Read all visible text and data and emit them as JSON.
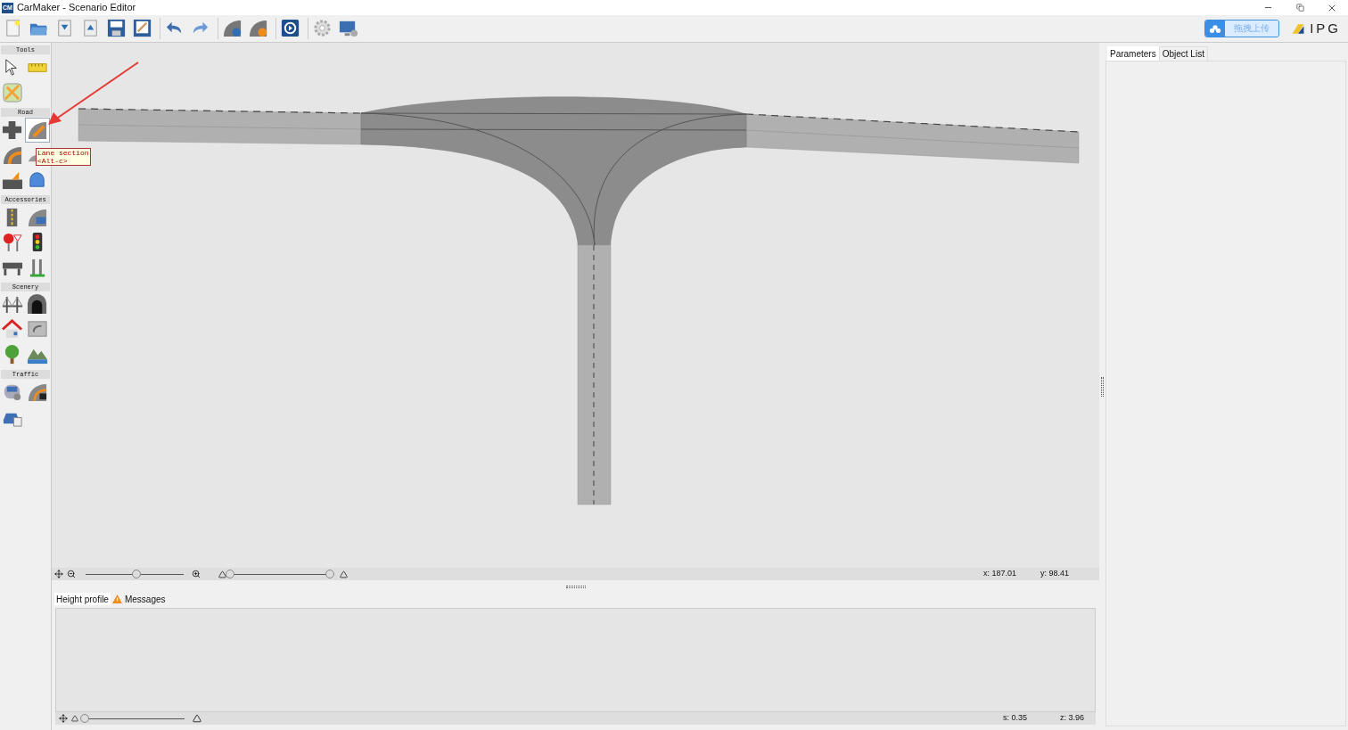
{
  "window": {
    "app_badge": "CM",
    "title": "CarMaker - Scenario Editor"
  },
  "toolbar": {
    "tools": [
      {
        "kind": "new"
      },
      {
        "kind": "open"
      },
      {
        "kind": "import"
      },
      {
        "kind": "export"
      },
      {
        "kind": "save"
      },
      {
        "kind": "saveas"
      },
      {
        "kind": "undo"
      },
      {
        "kind": "redo"
      },
      {
        "kind": "roadinfo"
      },
      {
        "kind": "roadhelp"
      },
      {
        "kind": "play"
      },
      {
        "kind": "settings"
      },
      {
        "kind": "display"
      }
    ],
    "upload_button": "拖拽上传",
    "logo": "IPG"
  },
  "sidebar": {
    "sections": [
      {
        "title": "Tools",
        "tools": [
          {
            "kind": "pointer",
            "selected": false
          },
          {
            "kind": "ruler",
            "selected": false
          },
          {
            "kind": "map",
            "selected": false
          }
        ]
      },
      {
        "title": "Road",
        "tools": [
          {
            "kind": "junction",
            "selected": false
          },
          {
            "kind": "lanesection",
            "selected": true
          },
          {
            "kind": "curve",
            "selected": false
          },
          {
            "kind": "bump",
            "selected": false
          },
          {
            "kind": "ramp",
            "selected": false
          },
          {
            "kind": "dome",
            "selected": false
          }
        ]
      },
      {
        "title": "Accessories",
        "tools": [
          {
            "kind": "marking",
            "selected": false
          },
          {
            "kind": "roadsign",
            "selected": false
          },
          {
            "kind": "stop",
            "selected": false
          },
          {
            "kind": "trafficlight",
            "selected": false
          },
          {
            "kind": "barrier",
            "selected": false
          },
          {
            "kind": "post",
            "selected": false
          }
        ]
      },
      {
        "title": "Scenery",
        "tools": [
          {
            "kind": "bridge",
            "selected": false
          },
          {
            "kind": "tunnel",
            "selected": false
          },
          {
            "kind": "house",
            "selected": false
          },
          {
            "kind": "billboard",
            "selected": false
          },
          {
            "kind": "tree",
            "selected": false
          },
          {
            "kind": "landscape",
            "selected": false
          }
        ]
      },
      {
        "title": "Traffic",
        "tools": [
          {
            "kind": "vehicle",
            "selected": false
          },
          {
            "kind": "route",
            "selected": false
          },
          {
            "kind": "car",
            "selected": false
          }
        ]
      }
    ]
  },
  "tooltip": {
    "lines": [
      "Lane section",
      "<Alt-c>"
    ]
  },
  "canvas": {
    "zoom_slider": {
      "level": 0.52
    },
    "height_range": {
      "low": {
        "level": 0
      },
      "high": {
        "level": 1
      }
    },
    "coords": [
      "x: 187.01",
      "y: 98.41"
    ]
  },
  "bottom_panel": {
    "tabs": [
      {
        "label": "Height profile",
        "selected": true,
        "kind": "plain"
      },
      {
        "label": "Messages",
        "selected": false,
        "kind": "warning"
      }
    ],
    "slider": {
      "level": 0
    },
    "readouts": [
      "s: 0.35",
      "z: 3.96"
    ]
  },
  "right_panel": {
    "tabs": [
      {
        "label": "Parameters",
        "selected": true
      },
      {
        "label": "Object List",
        "selected": false
      }
    ]
  }
}
